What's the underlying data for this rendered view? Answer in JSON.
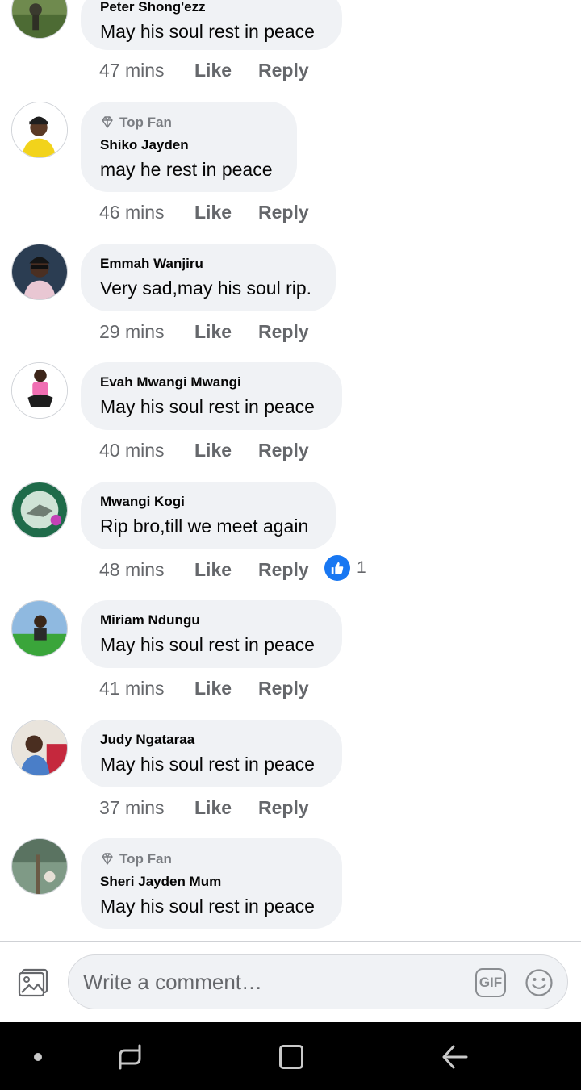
{
  "comments": [
    {
      "top_fan": "",
      "name": "Peter Shong'ezz",
      "text": "May his soul rest in peace",
      "time": "47 mins",
      "like": "Like",
      "reply": "Reply"
    },
    {
      "top_fan": "Top Fan",
      "name": "Shiko Jayden",
      "text": "may he rest in peace",
      "time": "46 mins",
      "like": "Like",
      "reply": "Reply"
    },
    {
      "top_fan": "",
      "name": "Emmah Wanjiru",
      "text": "Very sad,may his soul rip.",
      "time": "29 mins",
      "like": "Like",
      "reply": "Reply"
    },
    {
      "top_fan": "",
      "name": "Evah Mwangi Mwangi",
      "text": "May his soul rest in peace",
      "time": "40 mins",
      "like": "Like",
      "reply": "Reply"
    },
    {
      "top_fan": "",
      "name": "Mwangi Kogi",
      "text": "Rip bro,till we meet again",
      "time": "48 mins",
      "like": "Like",
      "reply": "Reply",
      "reaction_count": "1"
    },
    {
      "top_fan": "",
      "name": "Miriam Ndungu",
      "text": "May his soul rest in peace",
      "time": "41 mins",
      "like": "Like",
      "reply": "Reply"
    },
    {
      "top_fan": "",
      "name": "Judy Ngataraa",
      "text": "May his soul rest in peace",
      "time": "37 mins",
      "like": "Like",
      "reply": "Reply"
    },
    {
      "top_fan": "Top Fan",
      "name": "Sheri Jayden Mum",
      "text": "May his soul rest in peace",
      "time": "",
      "like": "",
      "reply": ""
    }
  ],
  "composer": {
    "placeholder": "Write a comment…",
    "gif_label": "GIF",
    "photo_icon": "photo-icon",
    "emoji_icon": "smiley-icon"
  },
  "navigation": {
    "icons": [
      "dot-icon",
      "recents-icon",
      "home-icon",
      "back-icon"
    ]
  },
  "colors": {
    "bubble": "#f0f2f5",
    "meta_text": "#65676b",
    "like_reaction": "#1877f2",
    "nav_bar": "#000000"
  }
}
